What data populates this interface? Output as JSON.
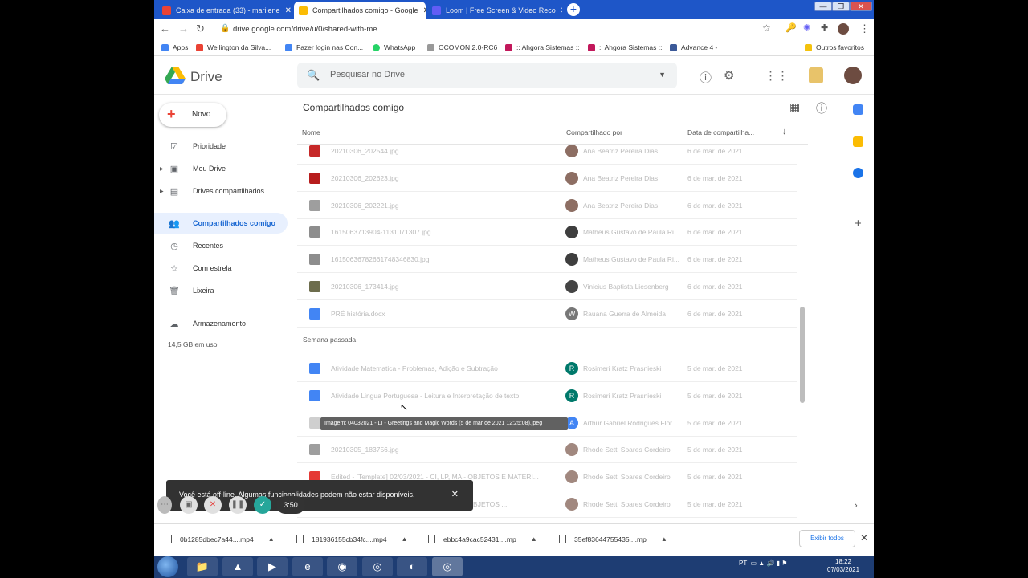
{
  "browser": {
    "tabs": [
      {
        "title": "Caixa de entrada (33) - marilene",
        "color": "#ea4335"
      },
      {
        "title": "Compartilhados comigo - Google",
        "color": "#fbbc04"
      },
      {
        "title": "Loom | Free Screen & Video Reco",
        "color": "#625df5"
      }
    ],
    "url": "drive.google.com/drive/u/0/shared-with-me",
    "bookmarks": [
      "Apps",
      "Wellington da Silva...",
      "Fazer login nas Con...",
      "WhatsApp",
      "OCOMON 2.0-RC6",
      ":: Ahgora Sistemas ::",
      ":: Ahgora Sistemas ::",
      "Advance 4 -",
      "Outros favoritos"
    ]
  },
  "app": {
    "name": "Drive",
    "search_placeholder": "Pesquisar no Drive",
    "new_label": "Novo"
  },
  "sidebar": {
    "items": [
      {
        "label": "Prioridade",
        "icon": "✓"
      },
      {
        "label": "Meu Drive",
        "icon": "▣"
      },
      {
        "label": "Drives compartilhados",
        "icon": "▤"
      },
      {
        "label": "Compartilhados comigo",
        "icon": "👥"
      },
      {
        "label": "Recentes",
        "icon": "◷"
      },
      {
        "label": "Com estrela",
        "icon": "☆"
      },
      {
        "label": "Lixeira",
        "icon": "🗑"
      },
      {
        "label": "Armazenamento",
        "icon": "☁"
      }
    ],
    "storage_used": "14,5 GB em uso"
  },
  "main": {
    "title": "Compartilhados comigo",
    "columns": [
      "Nome",
      "Compartilhado por",
      "Data de compartilha...",
      "↓"
    ],
    "section_label": "Semana passada",
    "rows": [
      {
        "name": "20210306_202544.jpg",
        "owner": "Ana Beatriz Pereira Dias",
        "date": "6 de mar. de 2021",
        "fcolor": "#c62828",
        "acolor": "#8d6e63",
        "ainit": ""
      },
      {
        "name": "20210306_202623.jpg",
        "owner": "Ana Beatriz Pereira Dias",
        "date": "6 de mar. de 2021",
        "fcolor": "#b71c1c",
        "acolor": "#8d6e63",
        "ainit": ""
      },
      {
        "name": "20210306_202221.jpg",
        "owner": "Ana Beatriz Pereira Dias",
        "date": "6 de mar. de 2021",
        "fcolor": "#9e9e9e",
        "acolor": "#8d6e63",
        "ainit": ""
      },
      {
        "name": "1615063713904-1131071307.jpg",
        "owner": "Matheus Gustavo de Paula Ri...",
        "date": "6 de mar. de 2021",
        "fcolor": "#8d8d8d",
        "acolor": "#3e3e3e",
        "ainit": ""
      },
      {
        "name": "1615063678266174834​6830.jpg",
        "owner": "Matheus Gustavo de Paula Ri...",
        "date": "6 de mar. de 2021",
        "fcolor": "#8d8d8d",
        "acolor": "#3e3e3e",
        "ainit": ""
      },
      {
        "name": "20210306_173414.jpg",
        "owner": "Vinicius Baptista Liesenberg",
        "date": "6 de mar. de 2021",
        "fcolor": "#6d6d4d",
        "acolor": "#444",
        "ainit": ""
      },
      {
        "name": "PRÉ história.docx",
        "owner": "Rauana Guerra de Almeida",
        "date": "6 de mar. de 2021",
        "fcolor": "#4285f4",
        "acolor": "#777",
        "ainit": "W"
      },
      {
        "name": "Atividade Matematica - Problemas, Adição e Subtração",
        "owner": "Rosimeri Kratz Prasnieski",
        "date": "5 de mar. de 2021",
        "fcolor": "#4285f4",
        "acolor": "#00796b",
        "ainit": "R"
      },
      {
        "name": "Atividade Lingua Portuguesa - Leitura e Interpretação de texto",
        "owner": "Rosimeri Kratz Prasnieski",
        "date": "5 de mar. de 2021",
        "fcolor": "#4285f4",
        "acolor": "#00796b",
        "ainit": "R"
      },
      {
        "name": "04032021 - LI - Greetings and Magic Words",
        "owner": "Arthur Gabriel Rodrigues Flor...",
        "date": "5 de mar. de 2021",
        "fcolor": "#cfcfcf",
        "acolor": "#4285f4",
        "ainit": "A"
      },
      {
        "name": "20210305_183756.jpg",
        "owner": "Rhode Setti Soares Cordeiro",
        "date": "5 de mar. de 2021",
        "fcolor": "#9e9e9e",
        "acolor": "#a1887f",
        "ainit": ""
      },
      {
        "name": "Edited - [Template] 02/03/2021 - CI, LP, MA - OBJETOS E MATERI...",
        "owner": "Rhode Setti Soares Cordeiro",
        "date": "5 de mar. de 2021",
        "fcolor": "#e53935",
        "acolor": "#a1887f",
        "ainit": ""
      },
      {
        "name": "Edited - [Template] 02/03/2021 - CI, LP, MA - OBJETOS ...",
        "owner": "Rhode Setti Soares Cordeiro",
        "date": "5 de mar. de 2021",
        "fcolor": "#e53935",
        "acolor": "#a1887f",
        "ainit": ""
      }
    ],
    "tooltip": "Imagem: 04032021 - LI - Greetings and Magic Words (5 de mar de 2021 12:25:08).jpeg"
  },
  "toast": {
    "message": "Você está off-line. Algumas funcionalidades podem não estar disponíveis.",
    "close": "✕"
  },
  "loom": {
    "timer": "3:50"
  },
  "downloads": {
    "items": [
      "0b1285dbec7a44....mp4",
      "181936155cb34fc....mp4",
      "ebbc4a9cac52431....mp",
      "35ef83644755435....mp"
    ],
    "show_all": "Exibir todos"
  },
  "taskbar": {
    "lang": "PT",
    "time": "18:22",
    "date": "07/03/2021"
  }
}
